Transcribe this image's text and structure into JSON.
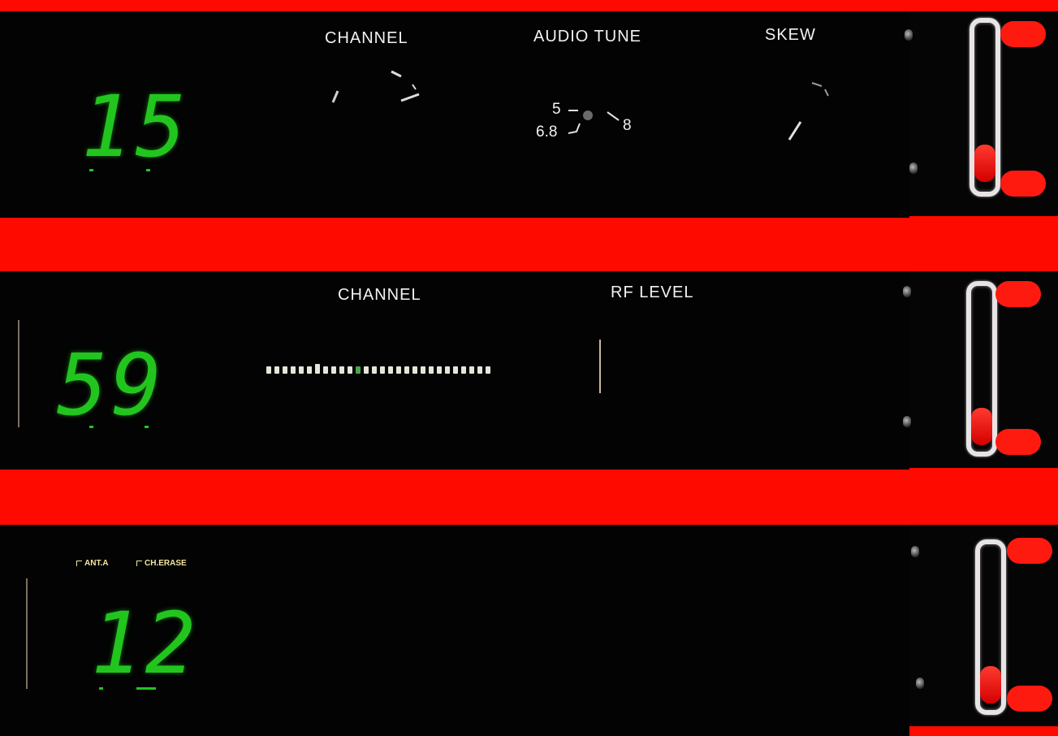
{
  "panels": [
    {
      "display": "15",
      "labels": {
        "channel": "CHANNEL",
        "audio_tune": "AUDIO TUNE",
        "skew": "SKEW"
      },
      "audio_tune_scale": [
        "5",
        "6.8",
        "8"
      ]
    },
    {
      "display": "59",
      "labels": {
        "channel": "CHANNEL",
        "rf_level": "RF LEVEL"
      }
    },
    {
      "display": "12",
      "indicators": [
        "ANT.A",
        "CH.ERASE"
      ]
    }
  ],
  "colors": {
    "rack_red": "#ff0a00",
    "panel_black": "#030303",
    "led_green": "#22c51e",
    "label_white": "#f2f2f2"
  }
}
